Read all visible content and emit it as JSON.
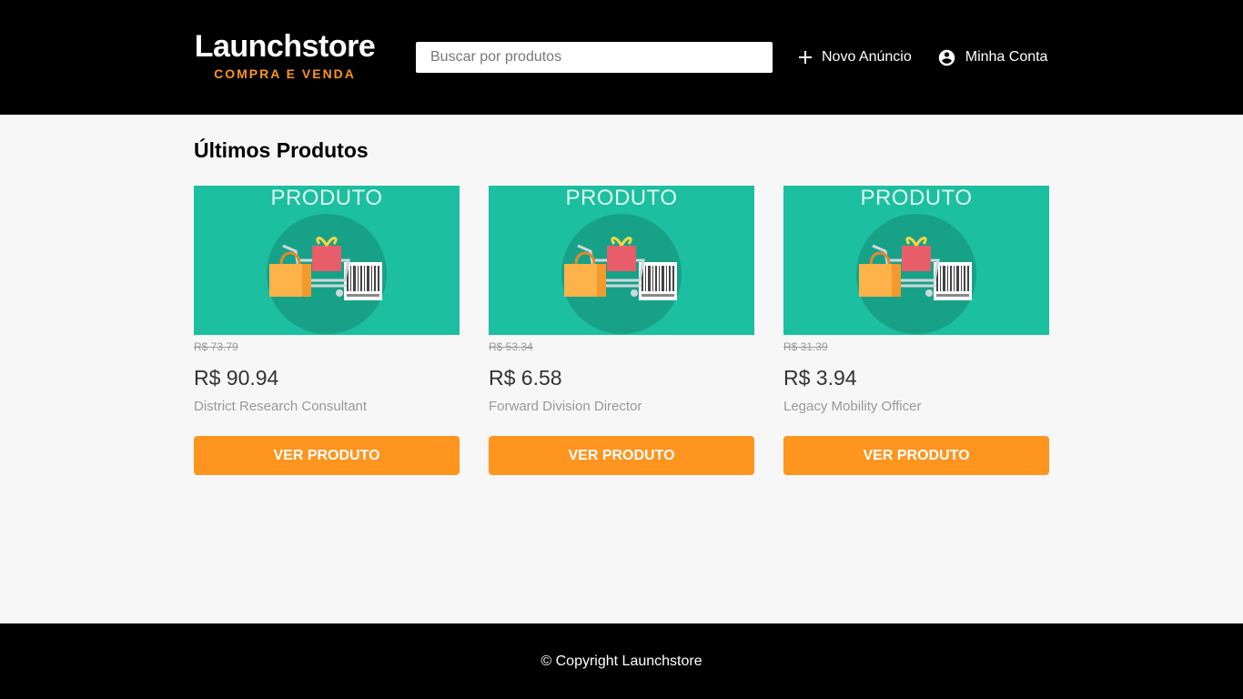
{
  "header": {
    "logo_title": "Launchstore",
    "logo_subtitle": "COMPRA E VENDA",
    "search_placeholder": "Buscar por produtos",
    "new_ad_label": "Novo Anúncio",
    "account_label": "Minha Conta",
    "new_ad_icon": "plus-icon",
    "account_icon": "account-circle-icon"
  },
  "main": {
    "section_title": "Últimos Produtos",
    "image_text": "PRODUTO",
    "products": [
      {
        "old_price": "R$ 73.79",
        "price": "R$ 90.94",
        "name": "District Research Consultant",
        "button": "VER PRODUTO"
      },
      {
        "old_price": "R$ 53.34",
        "price": "R$ 6.58",
        "name": "Forward Division Director",
        "button": "VER PRODUTO"
      },
      {
        "old_price": "R$ 31.39",
        "price": "R$ 3.94",
        "name": "Legacy Mobility Officer",
        "button": "VER PRODUTO"
      }
    ]
  },
  "footer": {
    "copyright": "© Copyright Launchstore"
  },
  "colors": {
    "accent": "#fd951f",
    "header_bg": "#000000",
    "card_image_bg": "#1cbf9f"
  }
}
